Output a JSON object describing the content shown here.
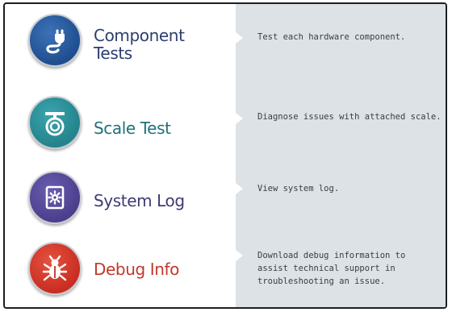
{
  "menu": {
    "items": [
      {
        "label": "Component\nTests",
        "description": "Test each hardware component.",
        "icon": "plug-icon",
        "color": "#1f4e8f",
        "label_color": "#2c3e6e"
      },
      {
        "label": "Scale Test",
        "description": "Diagnose issues with attached scale.",
        "icon": "scale-icon",
        "color": "#24838c",
        "label_color": "#22717a"
      },
      {
        "label": "System Log",
        "description": "View system log.",
        "icon": "gear-document-icon",
        "color": "#4b3f8c",
        "label_color": "#3e3a73"
      },
      {
        "label": "Debug Info",
        "description": "Download debug information to assist technical support in troubleshooting an issue.",
        "icon": "bug-icon",
        "color": "#c92d22",
        "label_color": "#c0392b"
      }
    ]
  }
}
